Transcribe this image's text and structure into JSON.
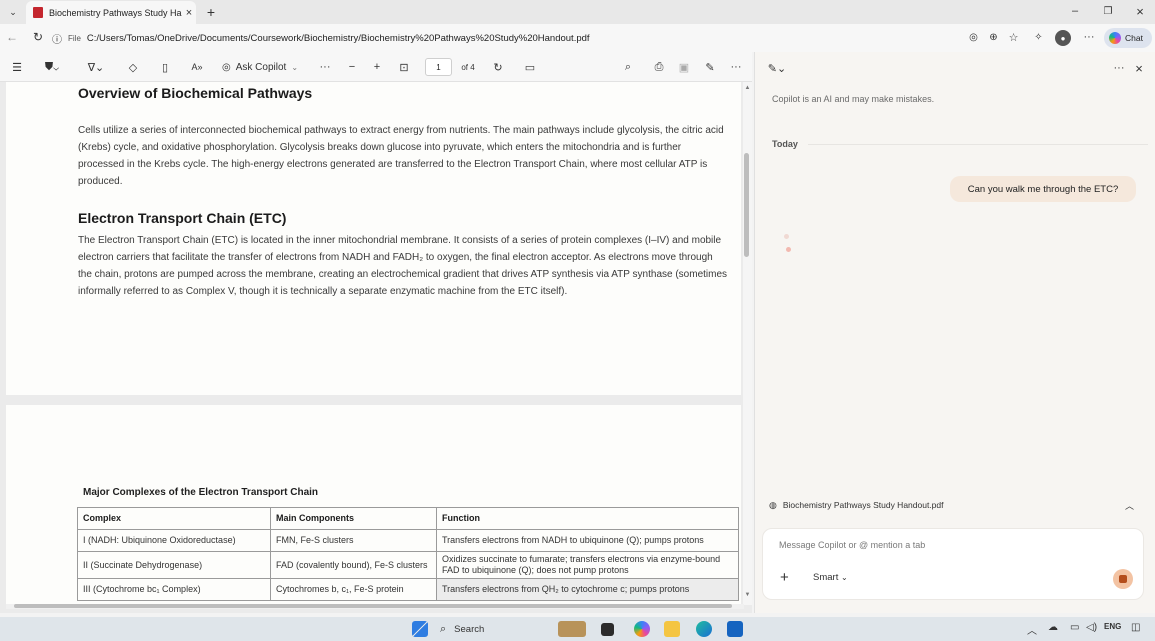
{
  "browser": {
    "tab_title": "Biochemistry Pathways Study Han",
    "new_tab": "+",
    "file_label": "File",
    "url": "C:/Users/Tomas/OneDrive/Documents/Coursework/Biochemistry/Biochemistry%20Pathways%20Study%20Handout.pdf",
    "chat_label": "Chat"
  },
  "pdf_toolbar": {
    "ask_copilot": "Ask Copilot",
    "current_page": "1",
    "page_total": "of 4"
  },
  "document": {
    "heading1": "Overview of Biochemical Pathways",
    "para1": "Cells utilize a series of interconnected biochemical pathways to extract energy from nutrients. The main pathways include glycolysis, the citric acid (Krebs) cycle, and oxidative phosphorylation. Glycolysis breaks down glucose into pyruvate, which enters the mitochondria and is further processed in the Krebs cycle. The high-energy electrons generated are transferred to the Electron Transport Chain, where most cellular ATP is produced.",
    "heading2": "Electron Transport Chain (ETC)",
    "para2": "The Electron Transport Chain (ETC) is located in the inner mitochondrial membrane. It consists of a series of protein complexes (I–IV) and mobile electron carriers that facilitate the transfer of electrons from NADH and FADH₂ to oxygen, the final electron acceptor. As electrons move through the chain, protons are pumped across the membrane, creating an electrochemical gradient that drives ATP synthesis via ATP synthase (sometimes informally referred to as Complex V, though it is technically a separate enzymatic machine from the ETC itself).",
    "table_title": "Major Complexes of the Electron Transport Chain",
    "table_headers": [
      "Complex",
      "Main Components",
      "Function"
    ],
    "table_rows": [
      [
        "I (NADH: Ubiquinone Oxidoreductase)",
        "FMN, Fe-S clusters",
        "Transfers electrons from NADH to ubiquinone (Q); pumps protons"
      ],
      [
        "II (Succinate Dehydrogenase)",
        "FAD (covalently bound), Fe-S clusters",
        "Oxidizes succinate to fumarate; transfers electrons via enzyme-bound FAD to ubiquinone (Q); does not pump protons"
      ],
      [
        "III (Cytochrome bc₁ Complex)",
        "Cytochromes b, c₁, Fe-S protein",
        "Transfers electrons from QH₂ to cytochrome c; pumps protons"
      ]
    ]
  },
  "copilot": {
    "disclaimer": "Copilot is an AI and may make mistakes.",
    "today": "Today",
    "user_message": "Can you walk me through the ETC?",
    "context_tab": "Biochemistry Pathways Study Handout.pdf",
    "input_placeholder": "Message Copilot or @ mention a tab",
    "mode": "Smart"
  },
  "taskbar": {
    "search": "Search"
  },
  "colors": {
    "bubble": "#f5e8dc",
    "pdf_icon": "#c4262e",
    "send": "#b44d1c"
  }
}
